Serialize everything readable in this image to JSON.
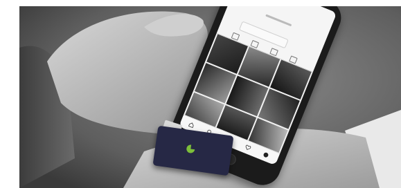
{
  "photo": {
    "subject": "hand-holding-phone-with-card-reader",
    "palette": {
      "skin": "#bdbdbd",
      "ground": "#6f6f6f",
      "jeans": "#c9c9c9",
      "dongle": "#262845",
      "logo": "#7dbf3a"
    }
  },
  "phone_screen": {
    "profile_name": "",
    "edit_button_label": ""
  },
  "icons": [
    "home-icon",
    "search-icon",
    "add-icon",
    "heart-icon",
    "profile-icon",
    "grid-icon",
    "list-icon",
    "bookmark-icon",
    "reader-logo-icon"
  ]
}
